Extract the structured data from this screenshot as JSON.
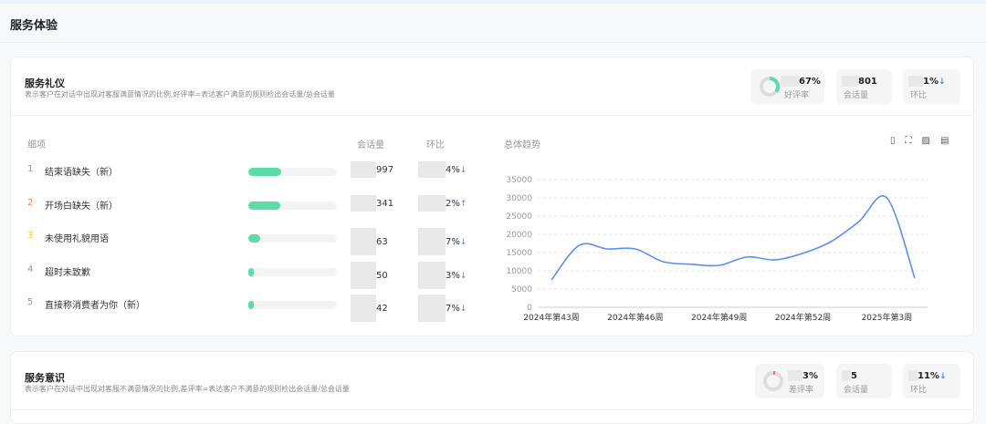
{
  "page_title": "服务体验",
  "sections": [
    {
      "title": "服务礼仪",
      "desc": "表示客户在对话中出现对客服满意情况的比例,好评率=表达客户满意的规则检出会话量/总会话量",
      "kpis": [
        {
          "value": "67%",
          "label": "好评率"
        },
        {
          "value": "801",
          "label": "会话量"
        },
        {
          "value": "1%",
          "label": "环比",
          "trend": "down"
        }
      ],
      "table_headers": {
        "item": "细项",
        "count": "会话量",
        "ratio": "环比"
      },
      "rows": [
        {
          "rank": "1",
          "label": "结束语缺失（新）",
          "bar_fraction": 0.37,
          "count": "997",
          "ratio": "4%",
          "trend": "down",
          "rank_color": "#f56c6c"
        },
        {
          "rank": "2",
          "label": "开场白缺失（新）",
          "bar_fraction": 0.36,
          "count": "341",
          "ratio": "2%",
          "trend": "up",
          "rank_color": "#f7894a"
        },
        {
          "rank": "3",
          "label": "未使用礼貌用语",
          "bar_fraction": 0.13,
          "count": "63",
          "ratio": "7%",
          "trend": "down",
          "rank_color": "#f5c518"
        },
        {
          "rank": "4",
          "label": "超时未致歉",
          "bar_fraction": 0.05,
          "count": "50",
          "ratio": "3%",
          "trend": "down",
          "rank_color": "#8a9bb5"
        },
        {
          "rank": "5",
          "label": "直接称消费者为你（新）",
          "bar_fraction": 0.04,
          "count": "42",
          "ratio": "7%",
          "trend": "down",
          "rank_color": "#8a9bb5"
        }
      ],
      "chart_title": "总体趋势",
      "tool_icons": [
        "book-icon",
        "fullscreen-icon",
        "image-icon",
        "export-icon"
      ]
    },
    {
      "title": "服务意识",
      "desc": "表示客户在对话中出现对客服不满意情况的比例,差评率=表达客户不满意的规则检出会话量/总会话量",
      "kpis": [
        {
          "value": "3%",
          "label": "差评率"
        },
        {
          "value": "5",
          "label": "会话量"
        },
        {
          "value": "11%",
          "label": "环比",
          "trend": "down"
        }
      ]
    }
  ],
  "colors": {
    "accent_green": "#5cdca6",
    "line_blue": "#5b8ff9",
    "trend_blue": "#3d8bff",
    "bad_red": "#f56c6c"
  },
  "chart_data": {
    "type": "line",
    "title": "总体趋势",
    "x": [
      "2024年第43周",
      "2024年第44周",
      "2024年第45周",
      "2024年第46周",
      "2024年第47周",
      "2024年第48周",
      "2024年第49周",
      "2024年第50周",
      "2024年第51周",
      "2024年第52周",
      "2025年第1周",
      "2025年第2周",
      "2025年第3周",
      "2025年第4周"
    ],
    "x_tick_labels": [
      "2024年第43周",
      "2024年第46周",
      "2024年第49周",
      "2024年第52周",
      "2025年第3周"
    ],
    "values": [
      7500,
      17000,
      16000,
      16000,
      12500,
      11800,
      11500,
      13800,
      13000,
      14800,
      18000,
      23500,
      30000,
      8000
    ],
    "y_ticks": [
      "0",
      "5000",
      "10000",
      "15000",
      "20000",
      "25000",
      "30000",
      "35000"
    ],
    "ylim": [
      0,
      35000
    ],
    "grid": true,
    "smooth": true
  }
}
